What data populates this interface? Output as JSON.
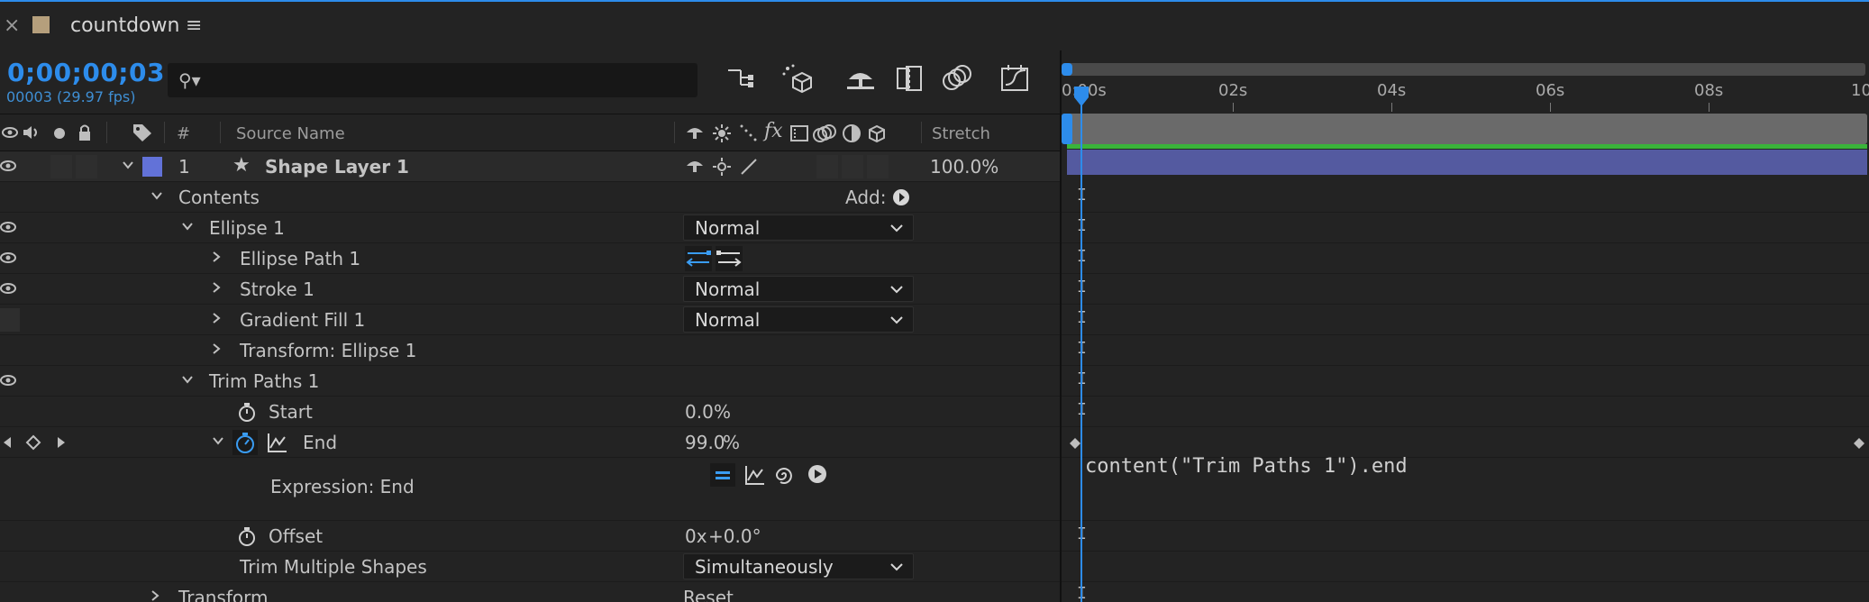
{
  "tab": {
    "close_label": "×",
    "title": "countdown",
    "menu_label": "≡",
    "swatch_color": "#b59f7c"
  },
  "comp": {
    "timecode": "0;00;00;03",
    "frame_info": "00003 (29.97 fps)",
    "search_placeholder": "",
    "search_icon_glyph": "⚲▾"
  },
  "toolbar": {
    "icons": [
      "composition-mini-flowchart-icon",
      "draft-3d-icon",
      "shy-layers-icon",
      "frame-blending-icon",
      "motion-blur-icon",
      "graph-editor-icon"
    ]
  },
  "columns": {
    "number": "#",
    "source_name": "Source Name",
    "switch_fx": "fx",
    "stretch": "Stretch"
  },
  "layer": {
    "number": "1",
    "star": "★",
    "name": "Shape Layer 1",
    "label_color": "#6272d8",
    "stretch": "100.0%"
  },
  "properties": {
    "contents": "Contents",
    "add_label": "Add:",
    "ellipse_1": "Ellipse 1",
    "ellipse_1_mode": "Normal",
    "ellipse_path_1": "Ellipse Path 1",
    "stroke_1": "Stroke 1",
    "stroke_1_mode": "Normal",
    "gradient_fill_1": "Gradient Fill 1",
    "gradient_fill_1_mode": "Normal",
    "transform_ellipse_1": "Transform: Ellipse 1",
    "trim_paths_1": "Trim Paths 1",
    "start": "Start",
    "start_value": "0.0",
    "end": "End",
    "end_value": "99.0",
    "percent": "%",
    "expression_end": "Expression: End",
    "offset": "Offset",
    "offset_rev": "0x",
    "offset_deg": "+0.0°",
    "trim_multiple": "Trim Multiple Shapes",
    "trim_multiple_value": "Simultaneously",
    "transform": "Transform",
    "transform_reset": "Reset"
  },
  "timeline": {
    "ticks": [
      "0:00s",
      "02s",
      "04s",
      "06s",
      "08s",
      "10"
    ],
    "expression_text": "content(\"Trim Paths 1\").end"
  },
  "colors": {
    "accent_blue": "#2d8ceb",
    "value_blue": "#3a9cf2",
    "value_red": "#e0463e",
    "layer_bar": "#545aa0",
    "green_bar": "#3ab43a"
  }
}
